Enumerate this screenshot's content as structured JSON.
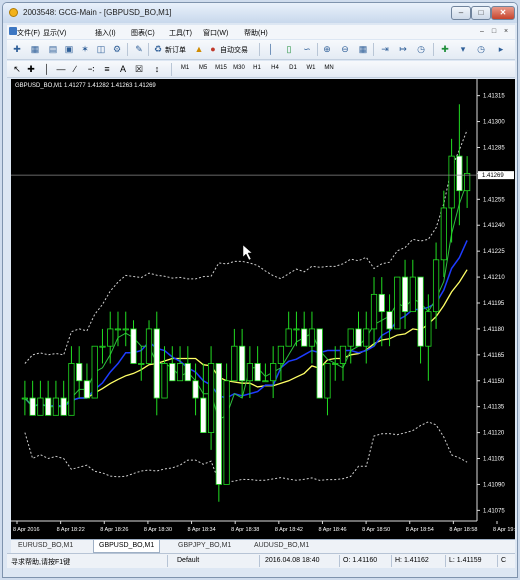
{
  "window": {
    "title": "2003548: GCG-Main - [GBPUSD_BO,M1]"
  },
  "menu": {
    "file": "文件(F)",
    "view": "显示(V)",
    "insert": "插入(I)",
    "chart": "图表(C)",
    "tools": "工具(T)",
    "window": "窗口(W)",
    "help": "帮助(H)"
  },
  "toolbar": {
    "new_order": "新订单",
    "auto_trading": "自动交易",
    "text_tool": "A",
    "timeframes": [
      "M1",
      "M5",
      "M15",
      "M30",
      "H1",
      "H4",
      "D1",
      "W1",
      "MN"
    ],
    "active_timeframe": "M1"
  },
  "chart": {
    "header": "GBPUSD_BO,M1  1.41277 1.41282 1.41263 1.41269",
    "current_price_label": "1.41269",
    "price_axis": [
      "1.41315",
      "1.41300",
      "1.41285",
      "1.41270",
      "1.41255",
      "1.41240",
      "1.41225",
      "1.41210",
      "1.41195",
      "1.41180",
      "1.41165",
      "1.41150",
      "1.41135",
      "1.41120",
      "1.41105",
      "1.41090",
      "1.41075"
    ],
    "time_axis": [
      "8 Apr 2016",
      "8 Apr 18:22",
      "8 Apr 18:26",
      "8 Apr 18:30",
      "8 Apr 18:34",
      "8 Apr 18:38",
      "8 Apr 18:42",
      "8 Apr 18:46",
      "8 Apr 18:50",
      "8 Apr 18:54",
      "8 Apr 18:58",
      "8 Apr 19:02"
    ]
  },
  "chart_data": {
    "type": "candlestick",
    "symbol": "GBPUSD_BO",
    "timeframe": "M1",
    "ylim": [
      1.4107,
      1.4132
    ],
    "last_price": 1.41269,
    "candles": [
      [
        1.4114,
        1.4115,
        1.4113,
        1.4114
      ],
      [
        1.4114,
        1.4115,
        1.4113,
        1.4113
      ],
      [
        1.4113,
        1.4115,
        1.4113,
        1.4114
      ],
      [
        1.4114,
        1.4115,
        1.4113,
        1.4113
      ],
      [
        1.4113,
        1.4115,
        1.4113,
        1.4114
      ],
      [
        1.4114,
        1.4115,
        1.4113,
        1.4113
      ],
      [
        1.4113,
        1.4117,
        1.4113,
        1.4116
      ],
      [
        1.4116,
        1.4117,
        1.4114,
        1.4115
      ],
      [
        1.4115,
        1.4116,
        1.4114,
        1.4114
      ],
      [
        1.4114,
        1.4117,
        1.4114,
        1.4117
      ],
      [
        1.4117,
        1.4118,
        1.4116,
        1.4117
      ],
      [
        1.4117,
        1.4119,
        1.4116,
        1.4118
      ],
      [
        1.4118,
        1.4119,
        1.4117,
        1.4118
      ],
      [
        1.4118,
        1.4119,
        1.4117,
        1.4118
      ],
      [
        1.4118,
        1.41185,
        1.4116,
        1.4116
      ],
      [
        1.4116,
        1.4117,
        1.4115,
        1.4116
      ],
      [
        1.4116,
        1.41185,
        1.4116,
        1.4118
      ],
      [
        1.4118,
        1.4119,
        1.4113,
        1.4114
      ],
      [
        1.4114,
        1.4117,
        1.4114,
        1.4116
      ],
      [
        1.4116,
        1.4117,
        1.4115,
        1.4115
      ],
      [
        1.4115,
        1.4117,
        1.4115,
        1.4116
      ],
      [
        1.4116,
        1.4117,
        1.4115,
        1.4115
      ],
      [
        1.4115,
        1.4116,
        1.4113,
        1.4114
      ],
      [
        1.4114,
        1.4116,
        1.4112,
        1.4112
      ],
      [
        1.4112,
        1.4117,
        1.4111,
        1.4116
      ],
      [
        1.4116,
        1.4116,
        1.4108,
        1.4109
      ],
      [
        1.4109,
        1.4116,
        1.4109,
        1.4115
      ],
      [
        1.4115,
        1.4118,
        1.4115,
        1.4117
      ],
      [
        1.4117,
        1.4118,
        1.4114,
        1.4115
      ],
      [
        1.4115,
        1.4117,
        1.4114,
        1.4116
      ],
      [
        1.4116,
        1.4117,
        1.4115,
        1.4115
      ],
      [
        1.4115,
        1.4116,
        1.4115,
        1.4115
      ],
      [
        1.4115,
        1.4117,
        1.4114,
        1.4116
      ],
      [
        1.4116,
        1.4117,
        1.4115,
        1.4117
      ],
      [
        1.4117,
        1.4119,
        1.4117,
        1.4118
      ],
      [
        1.4118,
        1.4119,
        1.4117,
        1.4118
      ],
      [
        1.4118,
        1.4119,
        1.4117,
        1.4117
      ],
      [
        1.4117,
        1.4119,
        1.4116,
        1.4118
      ],
      [
        1.4118,
        1.4118,
        1.4114,
        1.4114
      ],
      [
        1.4114,
        1.4116,
        1.4113,
        1.4116
      ],
      [
        1.4116,
        1.4117,
        1.4115,
        1.4116
      ],
      [
        1.4116,
        1.4117,
        1.4115,
        1.4117
      ],
      [
        1.4117,
        1.4118,
        1.4116,
        1.4118
      ],
      [
        1.4118,
        1.4119,
        1.4117,
        1.4117
      ],
      [
        1.4117,
        1.4119,
        1.4116,
        1.4118
      ],
      [
        1.4118,
        1.4121,
        1.4117,
        1.412
      ],
      [
        1.412,
        1.4121,
        1.4117,
        1.4119
      ],
      [
        1.4119,
        1.412,
        1.4117,
        1.4118
      ],
      [
        1.4118,
        1.4121,
        1.4118,
        1.4121
      ],
      [
        1.4121,
        1.4122,
        1.4118,
        1.4119
      ],
      [
        1.4119,
        1.4122,
        1.4119,
        1.4121
      ],
      [
        1.4121,
        1.4121,
        1.4116,
        1.4117
      ],
      [
        1.4117,
        1.412,
        1.4115,
        1.4119
      ],
      [
        1.4119,
        1.4123,
        1.4118,
        1.4122
      ],
      [
        1.4122,
        1.4126,
        1.4121,
        1.4125
      ],
      [
        1.4125,
        1.4129,
        1.4123,
        1.4128
      ],
      [
        1.4128,
        1.4131,
        1.4124,
        1.4126
      ],
      [
        1.4126,
        1.4128,
        1.4125,
        1.4127
      ]
    ],
    "indicators": [
      "Bollinger Bands",
      "Moving Average (blue)",
      "Moving Average (yellow)",
      "Moving Average (green)"
    ],
    "grid": false
  },
  "tabs": [
    "EURUSD_BO,M1",
    "GBPUSD_BO,M1",
    "GBPJPY_BO,M1",
    "AUDUSD_BO,M1"
  ],
  "active_tab": "GBPUSD_BO,M1",
  "status": {
    "help": "寻求帮助,请按F1键",
    "profile": "Default",
    "datetime": "2016.04.08 18:40",
    "open": "O: 1.41160",
    "high": "H: 1.41162",
    "low": "L: 1.41159",
    "close": "C"
  }
}
